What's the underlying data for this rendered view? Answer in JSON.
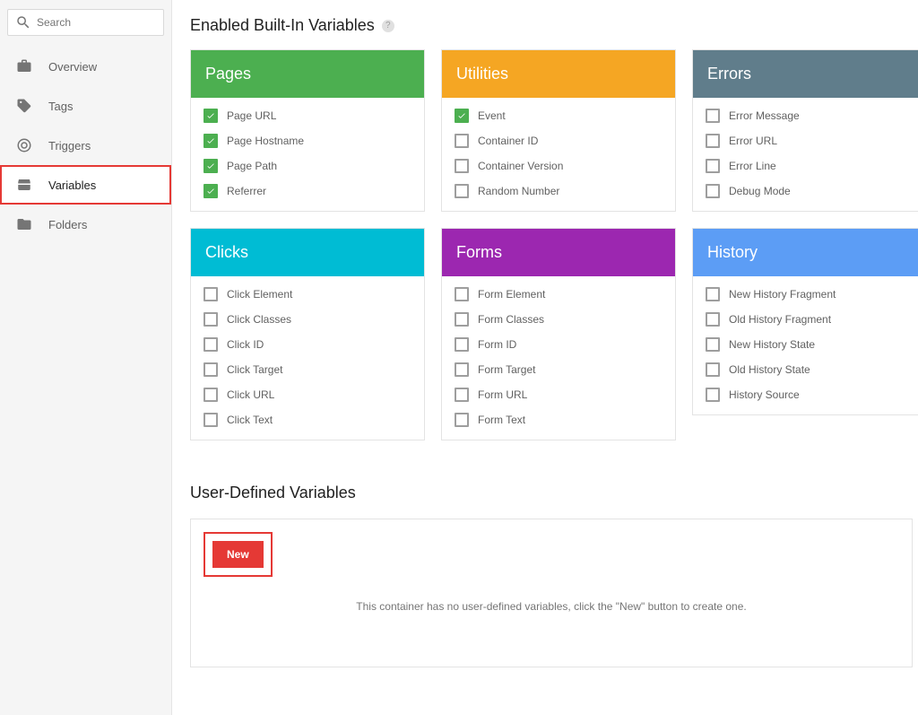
{
  "search": {
    "placeholder": "Search"
  },
  "nav": {
    "overview": "Overview",
    "tags": "Tags",
    "triggers": "Triggers",
    "variables": "Variables",
    "folders": "Folders"
  },
  "builtins": {
    "title": "Enabled Built-In Variables",
    "cards": {
      "pages": {
        "header": "Pages",
        "items": [
          {
            "label": "Page URL",
            "checked": true
          },
          {
            "label": "Page Hostname",
            "checked": true
          },
          {
            "label": "Page Path",
            "checked": true
          },
          {
            "label": "Referrer",
            "checked": true
          }
        ]
      },
      "utilities": {
        "header": "Utilities",
        "items": [
          {
            "label": "Event",
            "checked": true
          },
          {
            "label": "Container ID",
            "checked": false
          },
          {
            "label": "Container Version",
            "checked": false
          },
          {
            "label": "Random Number",
            "checked": false
          }
        ]
      },
      "errors": {
        "header": "Errors",
        "items": [
          {
            "label": "Error Message",
            "checked": false
          },
          {
            "label": "Error URL",
            "checked": false
          },
          {
            "label": "Error Line",
            "checked": false
          },
          {
            "label": "Debug Mode",
            "checked": false
          }
        ]
      },
      "clicks": {
        "header": "Clicks",
        "items": [
          {
            "label": "Click Element",
            "checked": false
          },
          {
            "label": "Click Classes",
            "checked": false
          },
          {
            "label": "Click ID",
            "checked": false
          },
          {
            "label": "Click Target",
            "checked": false
          },
          {
            "label": "Click URL",
            "checked": false
          },
          {
            "label": "Click Text",
            "checked": false
          }
        ]
      },
      "forms": {
        "header": "Forms",
        "items": [
          {
            "label": "Form Element",
            "checked": false
          },
          {
            "label": "Form Classes",
            "checked": false
          },
          {
            "label": "Form ID",
            "checked": false
          },
          {
            "label": "Form Target",
            "checked": false
          },
          {
            "label": "Form URL",
            "checked": false
          },
          {
            "label": "Form Text",
            "checked": false
          }
        ]
      },
      "history": {
        "header": "History",
        "items": [
          {
            "label": "New History Fragment",
            "checked": false
          },
          {
            "label": "Old History Fragment",
            "checked": false
          },
          {
            "label": "New History State",
            "checked": false
          },
          {
            "label": "Old History State",
            "checked": false
          },
          {
            "label": "History Source",
            "checked": false
          }
        ]
      }
    }
  },
  "userDefined": {
    "title": "User-Defined Variables",
    "newLabel": "New",
    "emptyMessage": "This container has no user-defined variables, click the \"New\" button to create one."
  }
}
